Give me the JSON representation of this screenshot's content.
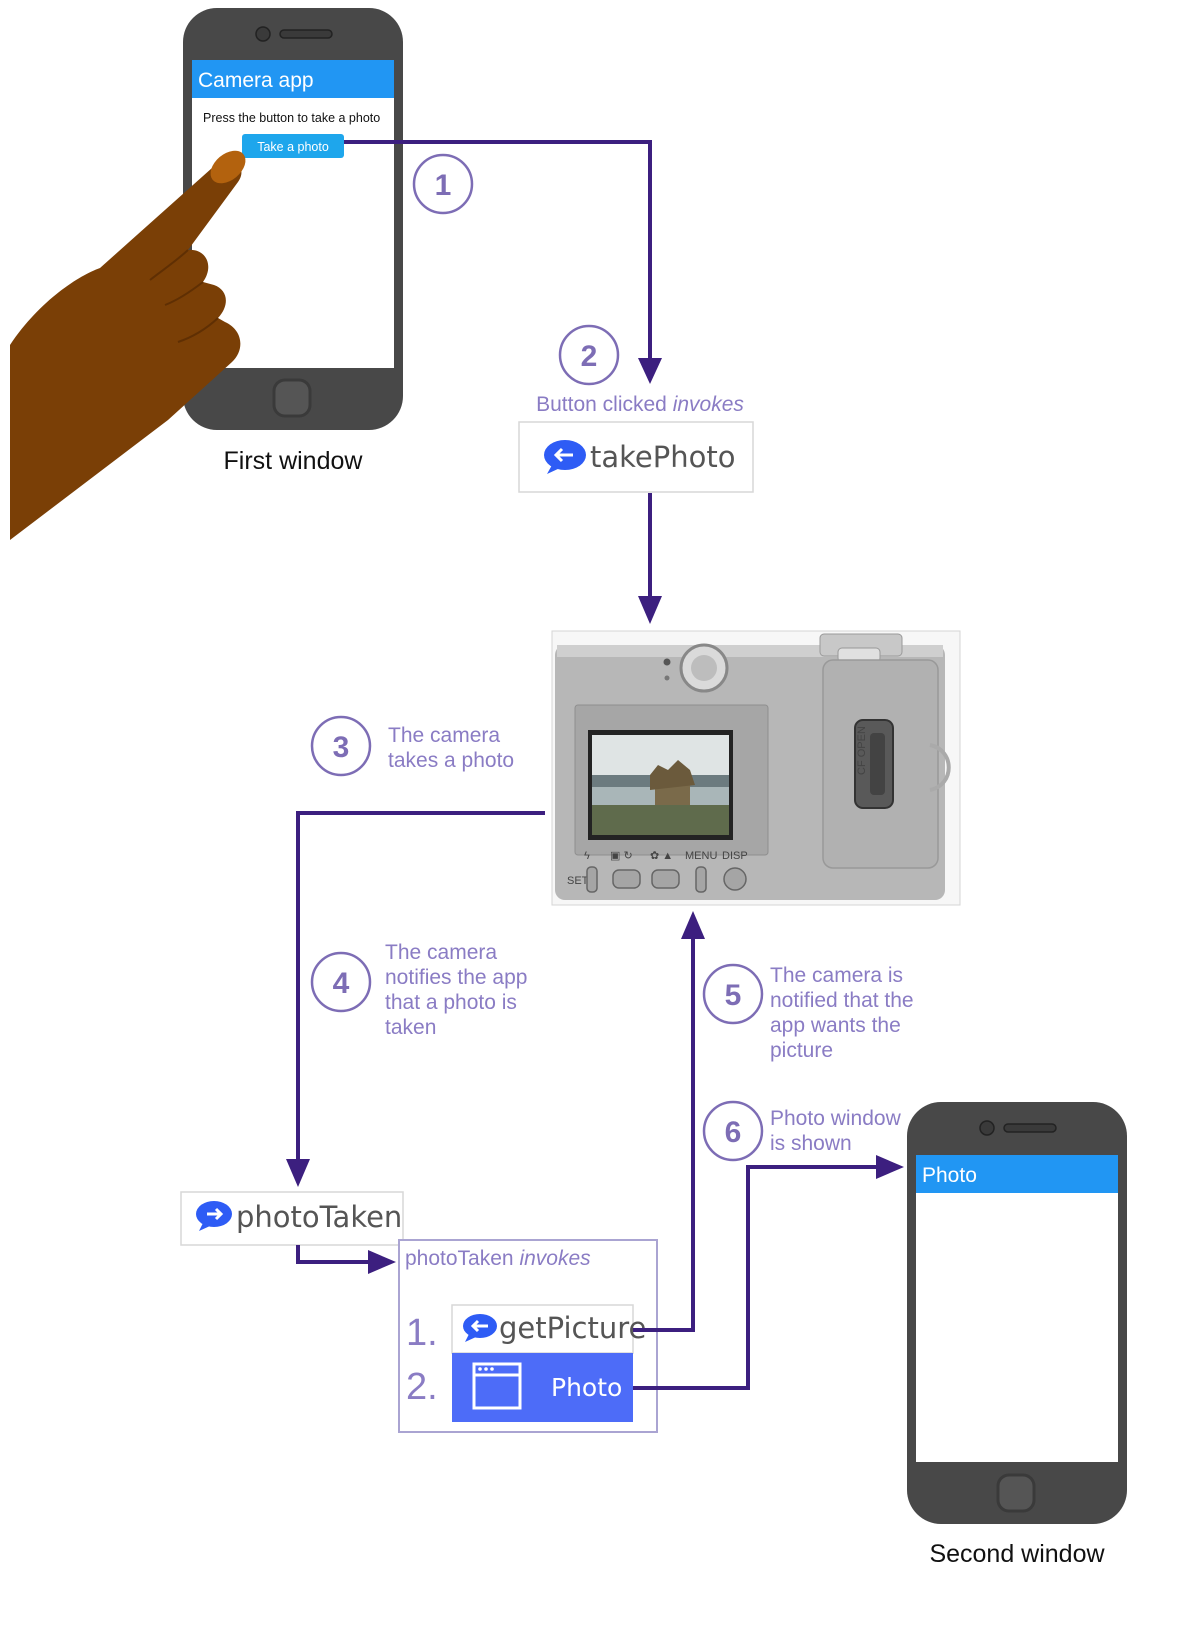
{
  "first_phone": {
    "title": "Camera app",
    "instruction": "Press the button to take a photo",
    "button_label": "Take a photo",
    "caption": "First window"
  },
  "second_phone": {
    "title": "Photo",
    "caption": "Second window"
  },
  "steps": [
    {
      "number": "1"
    },
    {
      "number": "2",
      "text_plain": "Button clicked ",
      "text_italic": "invokes"
    },
    {
      "number": "3",
      "lines": [
        "The camera",
        "takes a photo"
      ]
    },
    {
      "number": "4",
      "lines": [
        "The camera",
        "notifies the app",
        "that a photo is",
        "taken"
      ]
    },
    {
      "number": "5",
      "lines": [
        "The camera is",
        "notified that the",
        "app wants the",
        "picture"
      ]
    },
    {
      "number": "6",
      "lines": [
        "Photo window",
        "is shown"
      ]
    }
  ],
  "blocks": {
    "take_photo": "takePhoto",
    "photo_taken": "photoTaken",
    "get_picture": "getPicture",
    "photo_window": "Photo"
  },
  "invokes_panel": {
    "title_plain": "photoTaken ",
    "title_italic": "invokes",
    "item_numbers": [
      "1.",
      "2."
    ]
  },
  "colors": {
    "arrow": "#3c1f7f",
    "step_circle": "#7d6db5",
    "annotation_text": "#8a7cc4",
    "phone_header": "#2196f3",
    "phone_button": "#1ea6ec",
    "block_icon": "#2e5cf5",
    "photo_block_bg": "#4d6cf8",
    "hand": "#7a3f06"
  }
}
